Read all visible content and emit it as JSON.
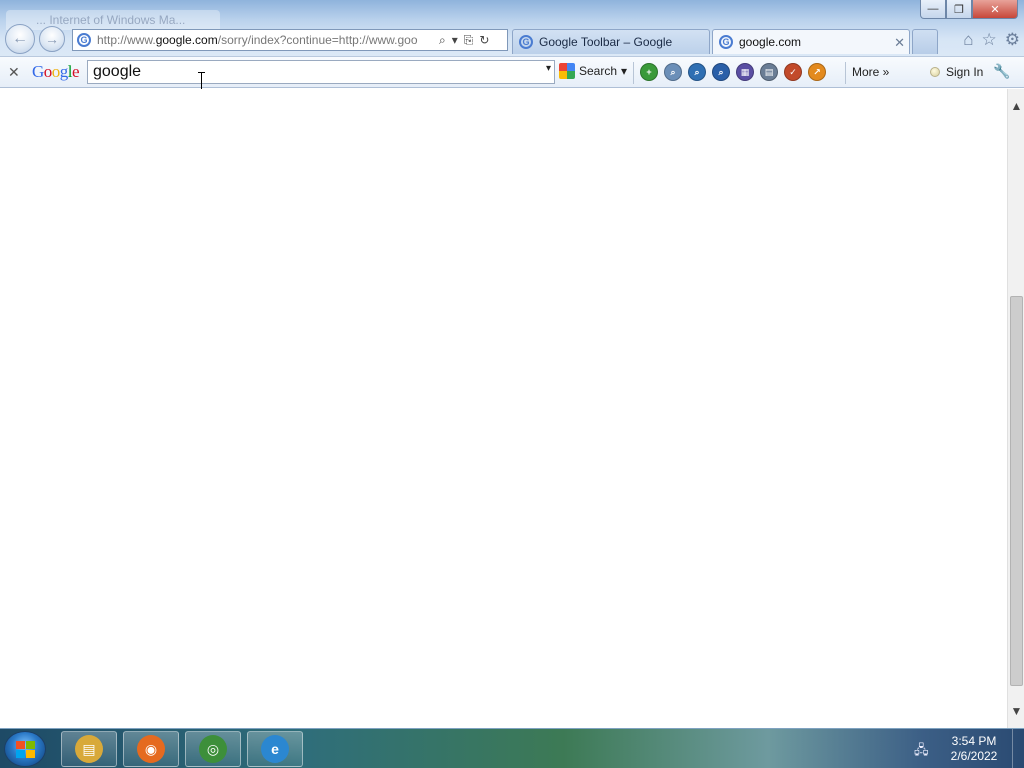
{
  "window": {
    "ghost_tab_title": "... Internet of Windows Ma...",
    "controls": {
      "minimize": "—",
      "restore": "❐",
      "close": "✕"
    }
  },
  "nav": {
    "back_icon": "back-arrow-icon",
    "forward_icon": "forward-arrow-icon",
    "address": {
      "scheme": "http://www.",
      "host": "google.com",
      "path": "/sorry/index?continue=http://www.goo",
      "search_glyph": "⌕",
      "dropdown_glyph": "▾",
      "compat_glyph": "⎘",
      "refresh_glyph": "↻"
    }
  },
  "tabs": [
    {
      "label": "Google Toolbar – Google",
      "favicon": "G"
    },
    {
      "label": "google.com",
      "favicon": "G",
      "close": "✕"
    }
  ],
  "right_icons": {
    "home": "⌂",
    "favorites": "☆",
    "tools": "⚙"
  },
  "google_toolbar": {
    "close_glyph": "✕",
    "logo": "Google",
    "logo_colors": [
      "#3369e8",
      "#d50f25",
      "#eeb211",
      "#3369e8",
      "#009925",
      "#d50f25"
    ],
    "query": "google",
    "dropdown_glyph": "▾",
    "search_label": "Search",
    "search_dropdown": "▾",
    "more_label": "More »",
    "signin_label": "Sign In",
    "wrench_glyph": "🔧",
    "buttons": [
      {
        "name": "bookmark-add-icon",
        "color": "#3a9a3a",
        "glyph": "+"
      },
      {
        "name": "find-icon",
        "color": "#6b8fb8",
        "glyph": "⌕"
      },
      {
        "name": "page-rank-icon",
        "color": "#2f6fb3",
        "glyph": "⌕"
      },
      {
        "name": "translate-icon",
        "color": "#2a5fa8",
        "glyph": "⌕"
      },
      {
        "name": "calendar-icon",
        "color": "#5a4ea3",
        "glyph": "▦"
      },
      {
        "name": "highlight-icon",
        "color": "#6a7d95",
        "glyph": "▤"
      },
      {
        "name": "spellcheck-icon",
        "color": "#c24a2a",
        "glyph": "✓"
      },
      {
        "name": "share-icon",
        "color": "#e38a1e",
        "glyph": "↗"
      }
    ]
  },
  "taskbar": {
    "apps": [
      {
        "name": "file-explorer",
        "color": "#d8a93a",
        "glyph": "▤"
      },
      {
        "name": "firefox",
        "color": "#e56a1f",
        "glyph": "◉"
      },
      {
        "name": "chrome",
        "color": "#3d8f3a",
        "glyph": "◎"
      },
      {
        "name": "internet-explorer",
        "color": "#2b87d1",
        "glyph": "e"
      }
    ],
    "tray_network_glyph": "🖧",
    "time": "3:54 PM",
    "date": "2/6/2022"
  },
  "scrollbar": {
    "up": "▲",
    "down": "▼"
  }
}
